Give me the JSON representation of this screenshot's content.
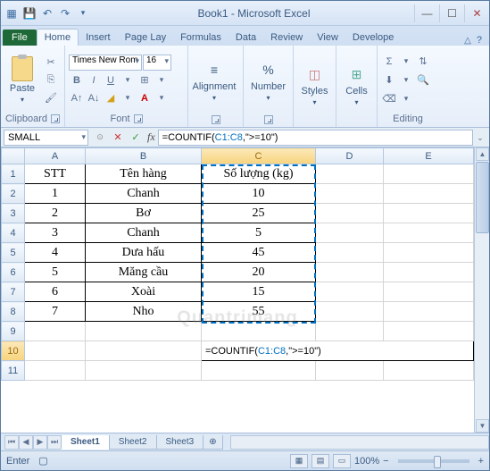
{
  "title": "Book1 - Microsoft Excel",
  "tabs": {
    "file": "File",
    "home": "Home",
    "insert": "Insert",
    "page": "Page Lay",
    "formulas": "Formulas",
    "data": "Data",
    "review": "Review",
    "view": "View",
    "developer": "Develope"
  },
  "ribbon": {
    "paste": "Paste",
    "clipboard": "Clipboard",
    "font": "Font",
    "alignment": "Alignment",
    "number": "Number",
    "styles": "Styles",
    "cells": "Cells",
    "editing": "Editing",
    "font_name": "Times New Rom",
    "font_size": "16"
  },
  "namebox": "SMALL",
  "formula_prefix": "=COUNTIF(",
  "formula_ref": "C1:C8",
  "formula_suffix": ",\">=10\")",
  "cols": [
    "A",
    "B",
    "C",
    "D",
    "E"
  ],
  "rows": [
    "1",
    "2",
    "3",
    "4",
    "5",
    "6",
    "7",
    "8",
    "9",
    "10",
    "11"
  ],
  "headers": {
    "stt": "STT",
    "ten": "Tên hàng",
    "sl": "Số lượng (kg)"
  },
  "data": [
    {
      "stt": "1",
      "ten": "Chanh",
      "sl": "10"
    },
    {
      "stt": "2",
      "ten": "Bơ",
      "sl": "25"
    },
    {
      "stt": "3",
      "ten": "Chanh",
      "sl": "5"
    },
    {
      "stt": "4",
      "ten": "Dưa hấu",
      "sl": "45"
    },
    {
      "stt": "5",
      "ten": "Măng cầu",
      "sl": "20"
    },
    {
      "stt": "6",
      "ten": "Xoài",
      "sl": "15"
    },
    {
      "stt": "7",
      "ten": "Nho",
      "sl": "55"
    }
  ],
  "cell_formula": {
    "prefix": "=COUNTIF(",
    "ref": "C1:C8",
    "suffix": ",\">=10\")"
  },
  "sheets": {
    "s1": "Sheet1",
    "s2": "Sheet2",
    "s3": "Sheet3"
  },
  "status": "Enter",
  "zoom": "100%",
  "zoom_minus": "−",
  "zoom_plus": "+",
  "watermark": "Quantrimang"
}
